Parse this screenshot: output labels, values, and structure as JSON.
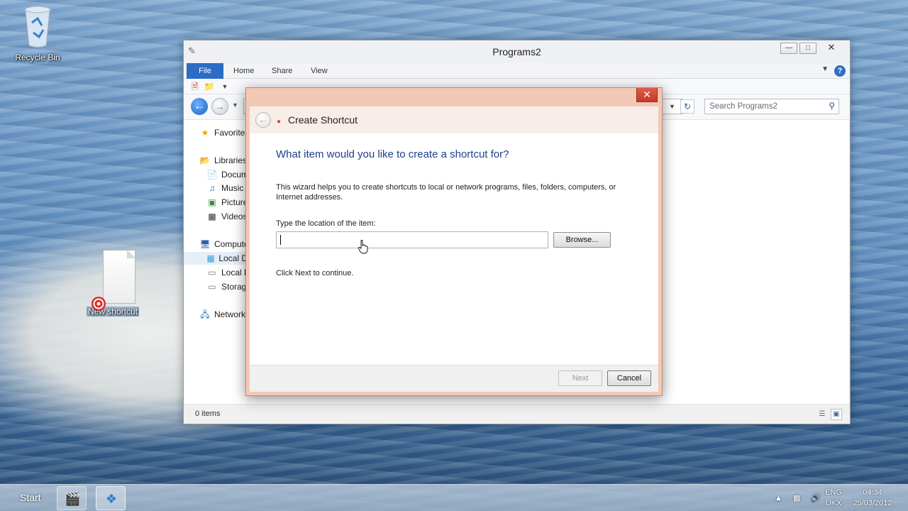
{
  "desktop": {
    "recycle_bin_label": "Recycle Bin",
    "shortcut_label": "New shortcut"
  },
  "explorer": {
    "title": "Programs2",
    "ribbon_tabs": [
      "File",
      "Home",
      "Share",
      "View"
    ],
    "search_placeholder": "Search Programs2",
    "nav_items": [
      "Favorites",
      "Libraries",
      "Docum",
      "Music",
      "Picture",
      "Videos",
      "Compute",
      "Local D",
      "Local D",
      "Storage",
      "Network"
    ],
    "status_count": "0 items"
  },
  "wizard": {
    "title": "Create Shortcut",
    "heading": "What item would you like to create a shortcut for?",
    "description": "This wizard helps you to create shortcuts to local or network programs, files, folders, computers, or Internet addresses.",
    "location_label": "Type the location of the item:",
    "location_value": "",
    "browse_label": "Browse...",
    "hint": "Click Next to continue.",
    "next_label": "Next",
    "cancel_label": "Cancel"
  },
  "taskbar": {
    "start_label": "Start",
    "lang_top": "ENG",
    "lang_bottom": "UKX",
    "time": "04:34",
    "date": "25/03/2012"
  },
  "colors": {
    "accent": "#2b6cc4",
    "wizard_frame": "#f3c8b5",
    "heading_blue": "#1e3f8a"
  }
}
